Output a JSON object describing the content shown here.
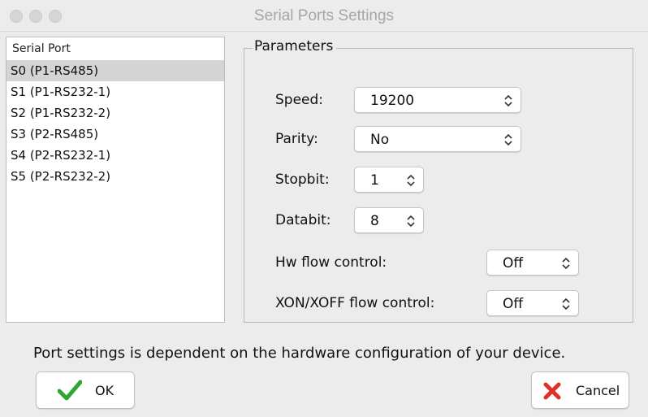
{
  "window": {
    "title": "Serial Ports Settings"
  },
  "port_list": {
    "header": "Serial Port",
    "items": [
      "S0 (P1-RS485)",
      "S1 (P1-RS232-1)",
      "S2 (P1-RS232-2)",
      "S3 (P2-RS485)",
      "S4 (P2-RS232-1)",
      "S5 (P2-RS232-2)"
    ],
    "selected": "S0 (P1-RS485)"
  },
  "parameters": {
    "title": "Parameters",
    "speed": {
      "label": "Speed:",
      "value": "19200"
    },
    "parity": {
      "label": "Parity:",
      "value": "No"
    },
    "stopbit": {
      "label": "Stopbit:",
      "value": "1"
    },
    "databit": {
      "label": "Databit:",
      "value": "8"
    },
    "hw_flow": {
      "label": "Hw flow control:",
      "value": "Off"
    },
    "xon_flow": {
      "label": "XON/XOFF flow control:",
      "value": "Off"
    }
  },
  "info_text": "Port settings is dependent on the hardware configuration of your device.",
  "buttons": {
    "ok": "OK",
    "cancel": "Cancel"
  },
  "colors": {
    "ok_icon": "#2fa533",
    "cancel_icon": "#e0302a",
    "selected_row": "#d4d4d4"
  }
}
